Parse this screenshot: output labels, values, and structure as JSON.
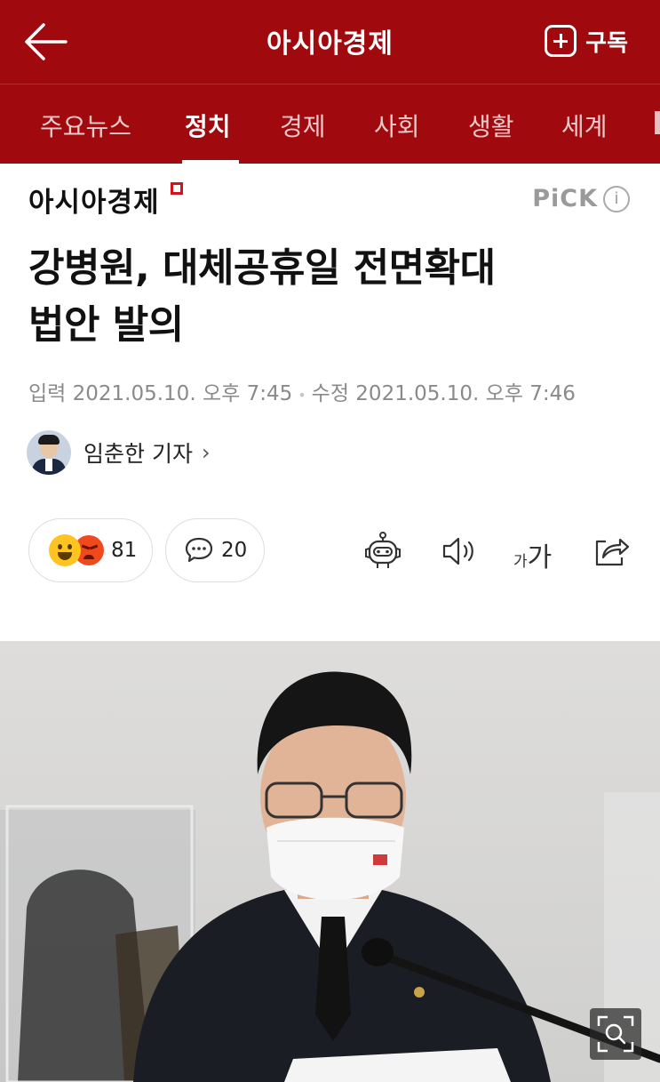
{
  "header": {
    "title": "아시아경제",
    "subscribe_label": "구독",
    "icons": {
      "back": "arrow-left-icon",
      "subscribe": "plus-square-icon"
    }
  },
  "tabs": [
    {
      "label": "주요뉴스",
      "active": false
    },
    {
      "label": "정치",
      "active": true
    },
    {
      "label": "경제",
      "active": false
    },
    {
      "label": "사회",
      "active": false
    },
    {
      "label": "생활",
      "active": false
    },
    {
      "label": "세계",
      "active": false
    }
  ],
  "article": {
    "press_name": "아시아경제",
    "pick_label": "PiCK",
    "info_glyph": "i",
    "headline_line1": "강병원, 대체공휴일 전면확대",
    "headline_line2": "법안 발의",
    "published": "입력 2021.05.10. 오후 7:45",
    "modified": "수정 2021.05.10. 오후 7:46",
    "author": "임춘한 기자",
    "author_chevron": "›"
  },
  "actions": {
    "reaction_count": "81",
    "comment_count": "20",
    "font_small": "가",
    "font_large": "가",
    "icons": [
      "robot-summary-icon",
      "speaker-icon",
      "font-size-icon",
      "share-icon"
    ]
  },
  "photo": {
    "description_icon": "article-photo",
    "zoom_icon": "zoom-icon"
  },
  "colors": {
    "brand_red": "#a0090e",
    "accent_red": "#d0141b",
    "meta_gray": "#8a8a8a"
  }
}
